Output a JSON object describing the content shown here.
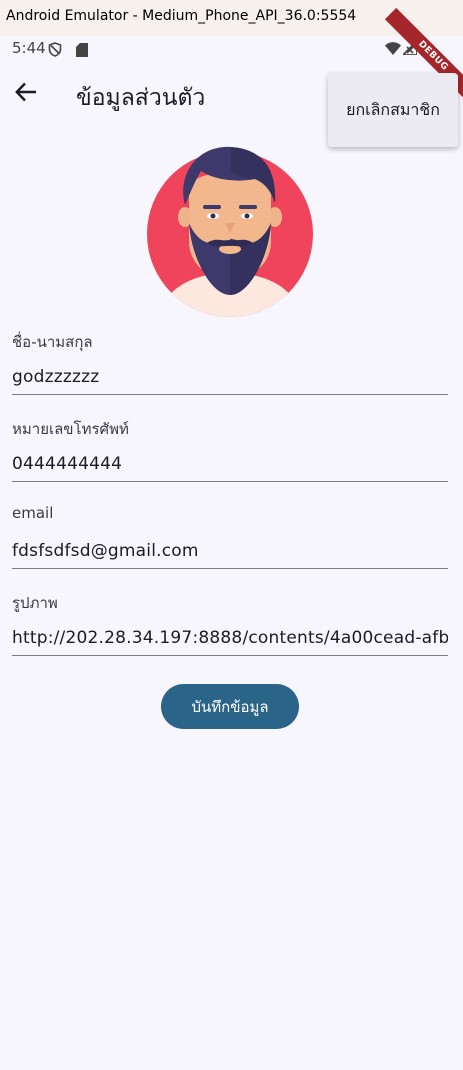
{
  "window": {
    "title": "Android Emulator - Medium_Phone_API_36.0:5554"
  },
  "status_bar": {
    "time": "5:44",
    "left_icons": [
      "shield-icon",
      "sd-card-icon"
    ],
    "right_icons": [
      "wifi-icon",
      "cellular-icon",
      "battery-icon"
    ],
    "debug_banner": "DEBUG"
  },
  "app_bar": {
    "back_icon": "arrow-back-icon",
    "title": "ข้อมูลส่วนตัว"
  },
  "popup_menu": {
    "items": [
      {
        "label": "ยกเลิกสมาชิก"
      }
    ]
  },
  "form": {
    "fields": [
      {
        "label": "ชื่อ-นามสกุล",
        "value": "godzzzzzz"
      },
      {
        "label": "หมายเลขโทรศัพท์",
        "value": "0444444444"
      },
      {
        "label": "email",
        "value": "fdsfsdfsd@gmail.com"
      },
      {
        "label": "รูปภาพ",
        "value": "http://202.28.34.197:8888/contents/4a00cead-afb"
      }
    ],
    "save_label": "บันทึกข้อมูล"
  },
  "colors": {
    "background": "#f7f6fd",
    "primary_button": "#2b6489",
    "avatar_circle": "#f0445c",
    "debug_ribbon": "#a5262a"
  }
}
